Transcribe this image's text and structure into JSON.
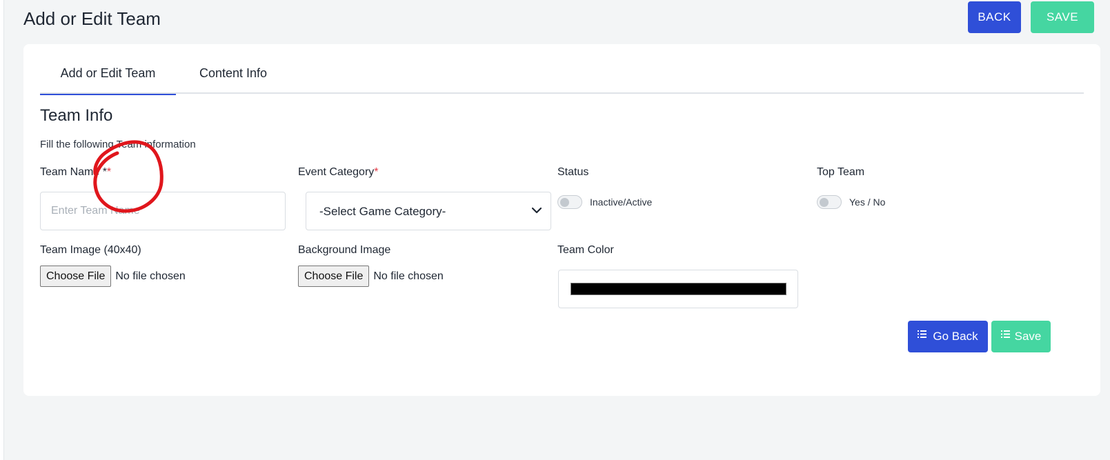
{
  "header": {
    "title": "Add or Edit Team",
    "back_label": "BACK",
    "save_label": "SAVE"
  },
  "tabs": [
    {
      "label": "Add or Edit Team",
      "active": true
    },
    {
      "label": "Content Info",
      "active": false
    }
  ],
  "form": {
    "section_title": "Team Info",
    "section_subtitle": "Fill the following Team information",
    "team_name": {
      "label": "Team Name *",
      "required_mark": "*",
      "placeholder": "Enter Team Name",
      "value": ""
    },
    "event_category": {
      "label": "Event Category",
      "required_mark": "*",
      "selected": "-Select Game Category-"
    },
    "status": {
      "label": "Status",
      "toggle_text": "Inactive/Active",
      "on": false
    },
    "top_team": {
      "label": "Top Team",
      "toggle_text": "Yes / No",
      "on": false
    },
    "team_image": {
      "label": "Team Image (40x40)",
      "button": "Choose File",
      "file_status": "No file chosen"
    },
    "background_image": {
      "label": "Background Image",
      "button": "Choose File",
      "file_status": "No file chosen"
    },
    "team_color": {
      "label": "Team Color",
      "value": "#000000"
    }
  },
  "actions": {
    "go_back_label": "Go Back",
    "save_label": "Save"
  },
  "colors": {
    "primary": "#2f4fd8",
    "success": "#45d6a1",
    "required": "#e53945",
    "annotation": "#e0161c"
  },
  "icons": {
    "select": "chevron-down-icon",
    "buttons": "list-icon"
  }
}
